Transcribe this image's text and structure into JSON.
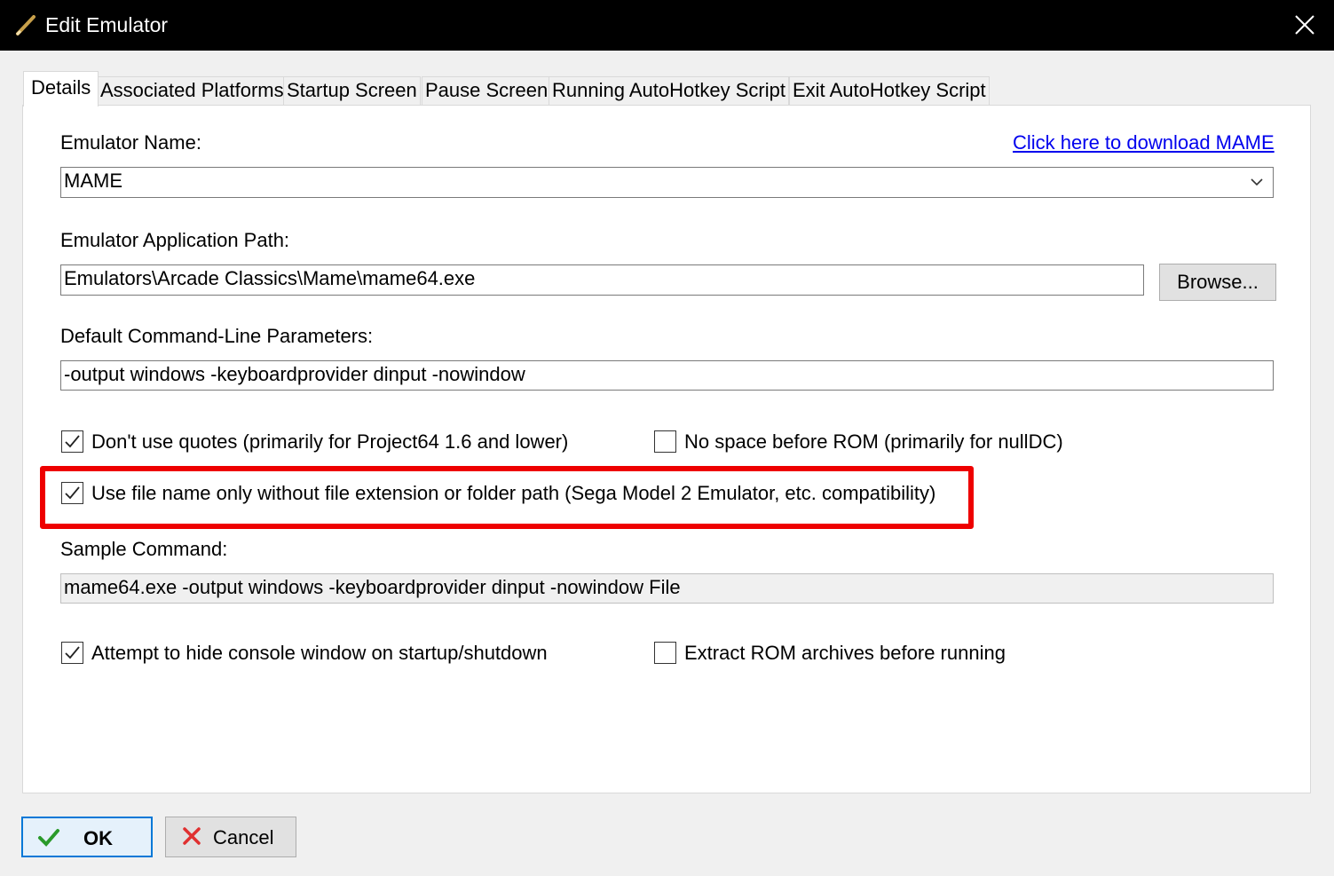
{
  "window": {
    "title": "Edit Emulator",
    "title_icon": "pencil-icon",
    "close_icon": "close-icon"
  },
  "tabs": [
    {
      "label": "Details",
      "active": true
    },
    {
      "label": "Associated Platforms",
      "active": false
    },
    {
      "label": "Startup Screen",
      "active": false
    },
    {
      "label": "Pause Screen",
      "active": false
    },
    {
      "label": "Running AutoHotkey Script",
      "active": false
    },
    {
      "label": "Exit AutoHotkey Script",
      "active": false
    }
  ],
  "details": {
    "emulator_name_label": "Emulator Name:",
    "download_link": "Click here to download MAME",
    "emulator_name_value": "MAME",
    "app_path_label": "Emulator Application Path:",
    "app_path_value": "Emulators\\Arcade Classics\\Mame\\mame64.exe",
    "browse_label": "Browse...",
    "params_label": "Default Command-Line Parameters:",
    "params_value": "-output windows -keyboardprovider dinput -nowindow",
    "checkboxes": {
      "no_quotes": {
        "label": "Don't use quotes (primarily for Project64 1.6 and lower)",
        "checked": true
      },
      "no_space": {
        "label": "No space before ROM (primarily for nullDC)",
        "checked": false
      },
      "file_name_only": {
        "label": "Use file name only without file extension or folder path (Sega Model 2 Emulator, etc. compatibility)",
        "checked": true
      },
      "hide_console": {
        "label": "Attempt to hide console window on startup/shutdown",
        "checked": true
      },
      "extract_rom": {
        "label": "Extract ROM archives before running",
        "checked": false
      }
    },
    "sample_label": "Sample Command:",
    "sample_value": "mame64.exe -output windows -keyboardprovider dinput -nowindow File"
  },
  "footer": {
    "ok_label": "OK",
    "cancel_label": "Cancel",
    "ok_icon": "checkmark-icon",
    "cancel_icon": "x-icon"
  },
  "colors": {
    "highlight": "#ee0000",
    "link": "#0000ee",
    "accent": "#0078d7"
  }
}
